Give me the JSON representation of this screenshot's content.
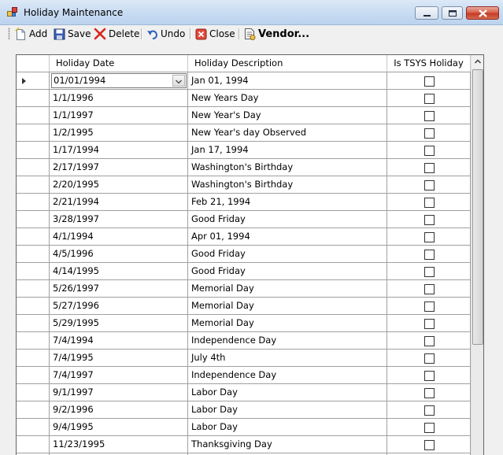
{
  "window": {
    "title": "Holiday Maintenance"
  },
  "toolbar": {
    "add_label": "Add",
    "save_label": "Save",
    "delete_label": "Delete",
    "undo_label": "Undo",
    "close_label": "Close",
    "vendor_label": "Vendor..."
  },
  "grid": {
    "columns": [
      "Holiday Date",
      "Holiday Description",
      "Is TSYS Holiday"
    ],
    "current_date_value": "01/01/1994",
    "rows": [
      {
        "date": "01/01/1994",
        "description": "Jan 01, 1994",
        "is_tsys": false
      },
      {
        "date": "1/1/1996",
        "description": "New Years Day",
        "is_tsys": false
      },
      {
        "date": "1/1/1997",
        "description": "New Year's Day",
        "is_tsys": false
      },
      {
        "date": "1/2/1995",
        "description": "New Year's day Observed",
        "is_tsys": false
      },
      {
        "date": "1/17/1994",
        "description": "Jan 17, 1994",
        "is_tsys": false
      },
      {
        "date": "2/17/1997",
        "description": "Washington's Birthday",
        "is_tsys": false
      },
      {
        "date": "2/20/1995",
        "description": "Washington's Birthday",
        "is_tsys": false
      },
      {
        "date": "2/21/1994",
        "description": "Feb 21, 1994",
        "is_tsys": false
      },
      {
        "date": "3/28/1997",
        "description": "Good Friday",
        "is_tsys": false
      },
      {
        "date": "4/1/1994",
        "description": "Apr 01, 1994",
        "is_tsys": false
      },
      {
        "date": "4/5/1996",
        "description": "Good Friday",
        "is_tsys": false
      },
      {
        "date": "4/14/1995",
        "description": "Good Friday",
        "is_tsys": false
      },
      {
        "date": "5/26/1997",
        "description": "Memorial Day",
        "is_tsys": false
      },
      {
        "date": "5/27/1996",
        "description": "Memorial Day",
        "is_tsys": false
      },
      {
        "date": "5/29/1995",
        "description": "Memorial Day",
        "is_tsys": false
      },
      {
        "date": "7/4/1994",
        "description": "Independence Day",
        "is_tsys": false
      },
      {
        "date": "7/4/1995",
        "description": "July 4th",
        "is_tsys": false
      },
      {
        "date": "7/4/1997",
        "description": "Independence Day",
        "is_tsys": false
      },
      {
        "date": "9/1/1997",
        "description": "Labor Day",
        "is_tsys": false
      },
      {
        "date": "9/2/1996",
        "description": "Labor Day",
        "is_tsys": false
      },
      {
        "date": "9/4/1995",
        "description": "Labor Day",
        "is_tsys": false
      },
      {
        "date": "11/23/1995",
        "description": "Thanksgiving Day",
        "is_tsys": false
      },
      {
        "date": "",
        "description": "",
        "is_tsys": false
      }
    ]
  },
  "icons": {
    "add": "new-document-icon",
    "save": "floppy-disk-icon",
    "delete": "red-x-icon",
    "undo": "undo-arrow-icon",
    "close": "close-box-icon",
    "vendor": "vendor-document-icon"
  },
  "colors": {
    "titlebar": "#c9dcf2",
    "close_button": "#c33d25",
    "grid_lines": "#a0a0a0"
  }
}
